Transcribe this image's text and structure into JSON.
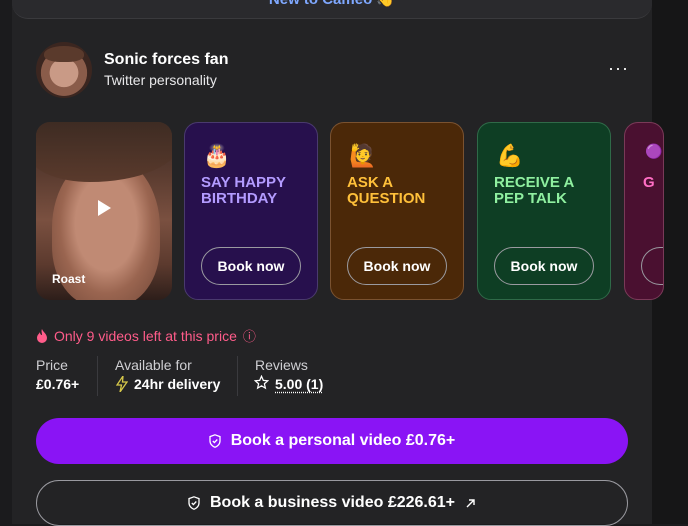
{
  "banner": {
    "text": "New to Cameo 👋"
  },
  "profile": {
    "name": "Sonic forces fan",
    "subtitle": "Twitter personality",
    "more_label": "···"
  },
  "tiles": [
    {
      "type": "video",
      "label": "Roast"
    },
    {
      "type": "offer",
      "emoji": "🎂",
      "title": "SAY HAPPY BIRTHDAY",
      "button": "Book now"
    },
    {
      "type": "offer",
      "emoji": "🙋",
      "title": "ASK A QUESTION",
      "button": "Book now"
    },
    {
      "type": "offer",
      "emoji": "💪",
      "title": "RECEIVE A PEP TALK",
      "button": "Book now"
    },
    {
      "type": "offer",
      "emoji": "🟣",
      "title": "G",
      "button": ""
    }
  ],
  "scarcity": {
    "text": "Only 9 videos left at this price",
    "info_icon": "ⓘ"
  },
  "stats": {
    "price_label": "Price",
    "price_value": "£0.76+",
    "availability_label": "Available for",
    "availability_value": "24hr delivery",
    "reviews_label": "Reviews",
    "reviews_value": "5.00 (1)"
  },
  "cta": {
    "personal": "Book a personal video £0.76+",
    "business": "Book a business video £226.61+"
  },
  "colors": {
    "accent_purple": "#8a14f5",
    "scarcity_pink": "#ff5c8a",
    "birthday_bg": "#27104d",
    "question_bg": "#4b2808",
    "pep_bg": "#0e3e24"
  }
}
